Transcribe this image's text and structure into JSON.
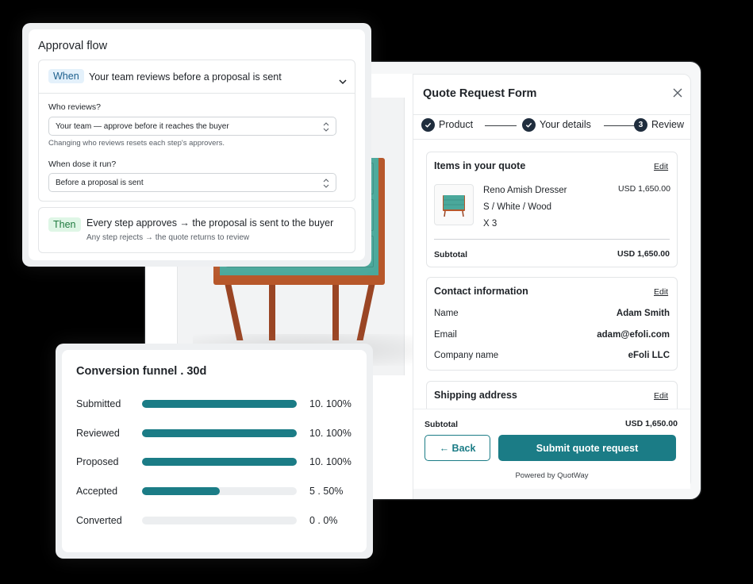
{
  "approval": {
    "title": "Approval flow",
    "when_tag": "When",
    "when_text": "Your team reviews before a proposal is sent",
    "who_label": "Who reviews?",
    "who_value": "Your team — approve before it reaches the buyer",
    "who_helper": "Changing who reviews resets each step's approvers.",
    "when_run_label": "When dose it run?",
    "when_run_value": "Before a proposal is sent",
    "then_tag": "Then",
    "then_text": "Every step approves → the proposal is sent to the buyer",
    "then_sub": "Any step rejects → the quote returns to review"
  },
  "quote": {
    "title": "Quote Request Form",
    "steps": [
      {
        "label": "Product",
        "state": "done"
      },
      {
        "label": "Your details",
        "state": "done"
      },
      {
        "label": "Review",
        "state": "current",
        "number": "3"
      }
    ],
    "items": {
      "title": "Items in your quote",
      "edit": "Edit",
      "product_name": "Reno Amish Dresser",
      "variant": "S / White / Wood",
      "qty": "X 3",
      "price": "USD 1,650.00",
      "subtotal_label": "Subtotal",
      "subtotal_value": "USD 1,650.00"
    },
    "contact": {
      "title": "Contact information",
      "edit": "Edit",
      "rows": [
        {
          "label": "Name",
          "value": "Adam Smith"
        },
        {
          "label": "Email",
          "value": "adam@efoli.com"
        },
        {
          "label": "Company name",
          "value": "eFoli LLC"
        }
      ]
    },
    "shipping": {
      "title": "Shipping address",
      "edit": "Edit"
    },
    "footer": {
      "subtotal_label": "Subtotal",
      "subtotal_value": "USD 1,650.00",
      "back": "← Back",
      "submit": "Submit quote request",
      "powered": "Powered by QuotWay"
    }
  },
  "funnel": {
    "title": "Conversion funnel . 30d",
    "rows": [
      {
        "label": "Submitted",
        "value": "10. 100%",
        "fraction": 1.0
      },
      {
        "label": "Reviewed",
        "value": "10. 100%",
        "fraction": 1.0
      },
      {
        "label": "Proposed",
        "value": "10. 100%",
        "fraction": 1.0
      },
      {
        "label": "Accepted",
        "value": "5 . 50%",
        "fraction": 0.5
      },
      {
        "label": "Converted",
        "value": "0 . 0%",
        "fraction": 0.0
      }
    ]
  },
  "colors": {
    "accent": "#1b7c86",
    "step_dark": "#1f2d3d",
    "when_pill": "#e4f1fb",
    "then_pill": "#dff6e6"
  }
}
